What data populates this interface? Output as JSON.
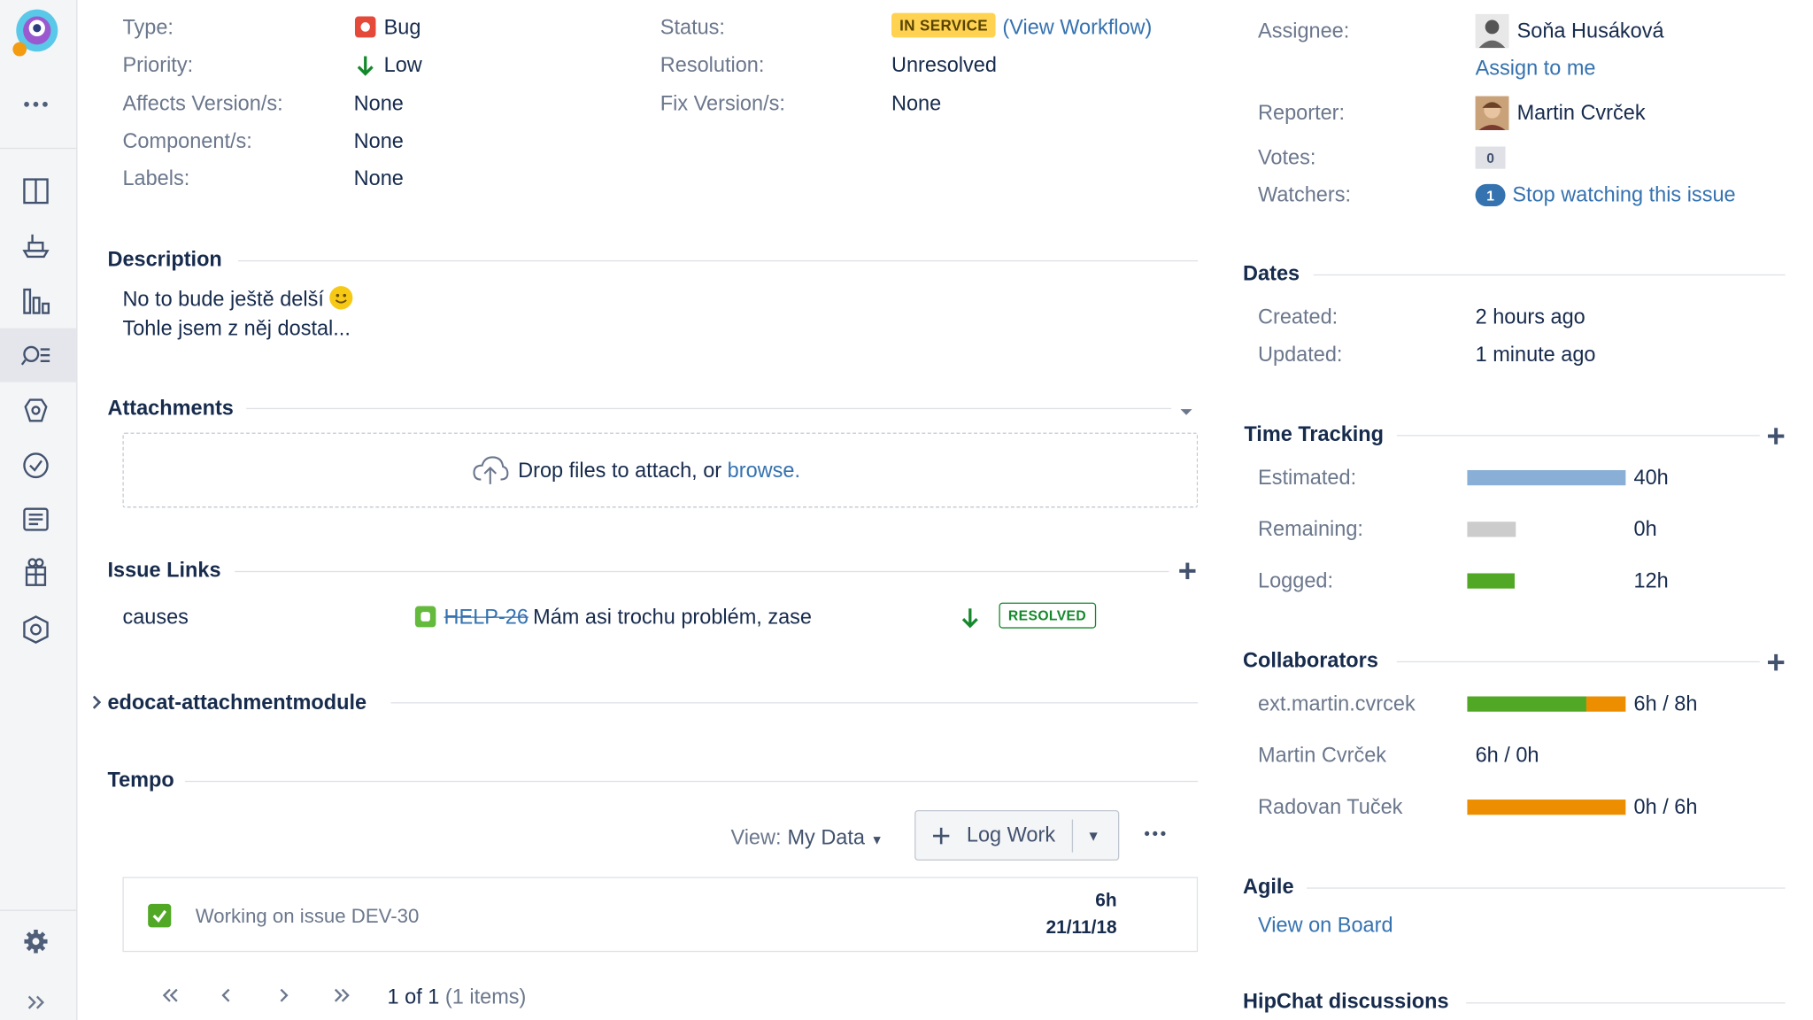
{
  "details": {
    "type_label": "Type:",
    "type_value": "Bug",
    "priority_label": "Priority:",
    "priority_value": "Low",
    "affects_label": "Affects Version/s:",
    "affects_value": "None",
    "components_label": "Component/s:",
    "components_value": "None",
    "labels_label": "Labels:",
    "labels_value": "None",
    "status_label": "Status:",
    "status_value": "IN SERVICE",
    "view_workflow": "View Workflow",
    "resolution_label": "Resolution:",
    "resolution_value": "Unresolved",
    "fix_label": "Fix Version/s:",
    "fix_value": "None"
  },
  "people": {
    "assignee_label": "Assignee:",
    "assignee_name": "Soňa Husáková",
    "assign_to_me": "Assign to me",
    "reporter_label": "Reporter:",
    "reporter_name": "Martin Cvrček",
    "votes_label": "Votes:",
    "votes_count": "0",
    "watchers_label": "Watchers:",
    "watchers_count": "1",
    "stop_watching": "Stop watching this issue"
  },
  "description": {
    "heading": "Description",
    "line1": "No to bude ještě delší",
    "line2": "Tohle jsem z něj dostal..."
  },
  "attachments": {
    "heading": "Attachments",
    "drop_text": "Drop files to attach, or",
    "browse": "browse."
  },
  "issue_links": {
    "heading": "Issue Links",
    "relation": "causes",
    "key": "HELP-26",
    "summary": "Mám asi trochu problém, zase",
    "status": "RESOLVED"
  },
  "module": {
    "heading": "edocat-attachmentmodule"
  },
  "tempo": {
    "heading": "Tempo",
    "view_label": "View:",
    "view_value": "My Data",
    "log_work": "Log Work",
    "entry_text": "Working on issue DEV-30",
    "entry_hours": "6h",
    "entry_date": "21/11/18",
    "pagination": "1 of 1",
    "items": "(1 items)"
  },
  "dates": {
    "heading": "Dates",
    "created_label": "Created:",
    "created_value": "2 hours ago",
    "updated_label": "Updated:",
    "updated_value": "1 minute ago"
  },
  "time_tracking": {
    "heading": "Time Tracking",
    "estimated_label": "Estimated:",
    "estimated_value": "40h",
    "estimated_hours": 40,
    "remaining_label": "Remaining:",
    "remaining_value": "0h",
    "remaining_hours": 0,
    "logged_label": "Logged:",
    "logged_value": "12h",
    "logged_hours": 12
  },
  "collaborators": {
    "heading": "Collaborators",
    "rows": [
      {
        "name": "ext.martin.cvrcek",
        "value": "6h / 8h",
        "logged_hours": 6,
        "estimated_hours": 8
      },
      {
        "name": "Martin Cvrček",
        "value": "6h / 0h",
        "logged_hours": 6,
        "estimated_hours": 0
      },
      {
        "name": "Radovan Tuček",
        "value": "0h / 6h",
        "logged_hours": 0,
        "estimated_hours": 6
      }
    ]
  },
  "agile": {
    "heading": "Agile",
    "view_on_board": "View on Board"
  },
  "hipchat": {
    "heading": "HipChat discussions"
  },
  "colors": {
    "link": "#3572b0",
    "bug_red": "#e5493a",
    "status_yellow": "#ffd351",
    "resolved_green": "#14892c",
    "estimated_blue": "#89afd7",
    "logged_green": "#51a825",
    "remaining_orange": "#ec8e00"
  }
}
